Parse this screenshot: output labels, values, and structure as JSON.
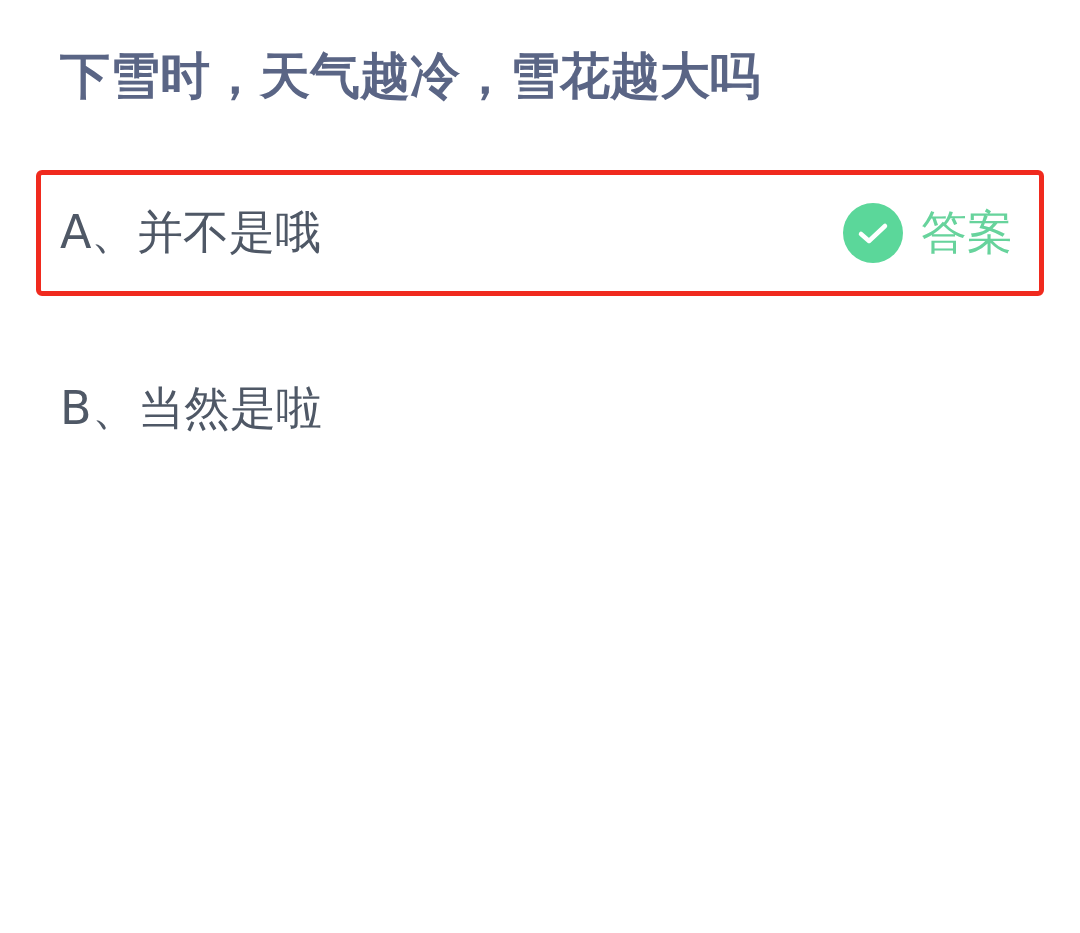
{
  "question": {
    "title": "下雪时，天气越冷，雪花越大吗"
  },
  "options": [
    {
      "text": "A、并不是哦",
      "highlighted": true,
      "answer_label": "答案"
    },
    {
      "text": "B、当然是啦",
      "highlighted": false
    }
  ]
}
